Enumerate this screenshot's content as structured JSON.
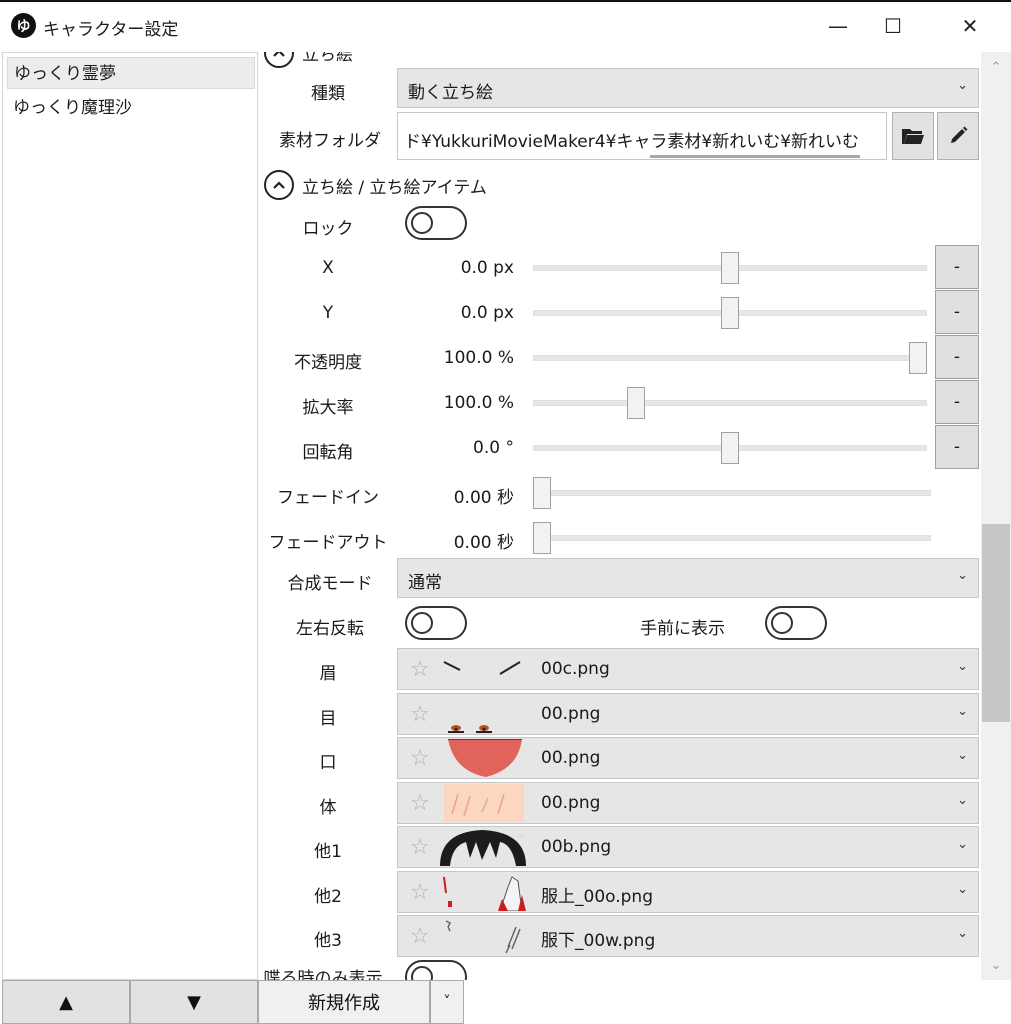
{
  "window": {
    "app_icon": "ゆ",
    "title": "キャラクター設定",
    "minimize": "—",
    "maximize": "☐",
    "close": "✕"
  },
  "character_list": {
    "items": [
      {
        "label": "ゆっくり霊夢",
        "selected": true
      },
      {
        "label": "ゆっくり魔理沙",
        "selected": false
      }
    ]
  },
  "bottom_bar": {
    "up_label": "▲",
    "down_label": "▼",
    "new_label": "新規作成",
    "dropdown_label": "˅"
  },
  "section_partial": {
    "title": "立ち絵"
  },
  "kind": {
    "label": "種類",
    "value": "動く立ち絵"
  },
  "folder": {
    "label": "素材フォルダ",
    "value": "ド¥YukkuriMovieMaker4¥キャラ素材¥新れいむ¥新れいむ"
  },
  "section_items": {
    "title": "立ち絵 / 立ち絵アイテム"
  },
  "lock": {
    "label": "ロック",
    "on": false
  },
  "params": [
    {
      "label": "X",
      "value": "0.0 px",
      "position": 0.5,
      "has_reset": true,
      "reset_label": "-"
    },
    {
      "label": "Y",
      "value": "0.0 px",
      "position": 0.5,
      "has_reset": true,
      "reset_label": "-"
    },
    {
      "label": "不透明度",
      "value": "100.0 %",
      "position": 1.0,
      "has_reset": true,
      "reset_label": "-"
    },
    {
      "label": "拡大率",
      "value": "100.0 %",
      "position": 0.25,
      "has_reset": true,
      "reset_label": "-"
    },
    {
      "label": "回転角",
      "value": "0.0 °",
      "position": 0.5,
      "has_reset": true,
      "reset_label": "-"
    },
    {
      "label": "フェードイン",
      "value": "0.00 秒",
      "position": 0.0,
      "has_reset": false
    },
    {
      "label": "フェードアウト",
      "value": "0.00 秒",
      "position": 0.0,
      "has_reset": false
    }
  ],
  "blend": {
    "label": "合成モード",
    "value": "通常"
  },
  "flip": {
    "label": "左右反転",
    "on": false
  },
  "front": {
    "label": "手前に表示",
    "on": false
  },
  "parts": [
    {
      "label": "眉",
      "file": "00c.png",
      "thumb": "eyebrow"
    },
    {
      "label": "目",
      "file": "00.png",
      "thumb": "eye"
    },
    {
      "label": "口",
      "file": "00.png",
      "thumb": "mouth"
    },
    {
      "label": "体",
      "file": "00.png",
      "thumb": "body"
    },
    {
      "label": "他1",
      "file": "00b.png",
      "thumb": "hair"
    },
    {
      "label": "他2",
      "file": "服上_00o.png",
      "thumb": "clothes-top"
    },
    {
      "label": "他3",
      "file": "服下_00w.png",
      "thumb": "clothes-bottom"
    }
  ],
  "speak_only": {
    "label": "喋る時のみ表示"
  },
  "colors": {
    "mouth": "#e0645c",
    "body": "#fbd7c2",
    "hair": "#1c1c1c",
    "clothes_red": "#c81e1e"
  }
}
